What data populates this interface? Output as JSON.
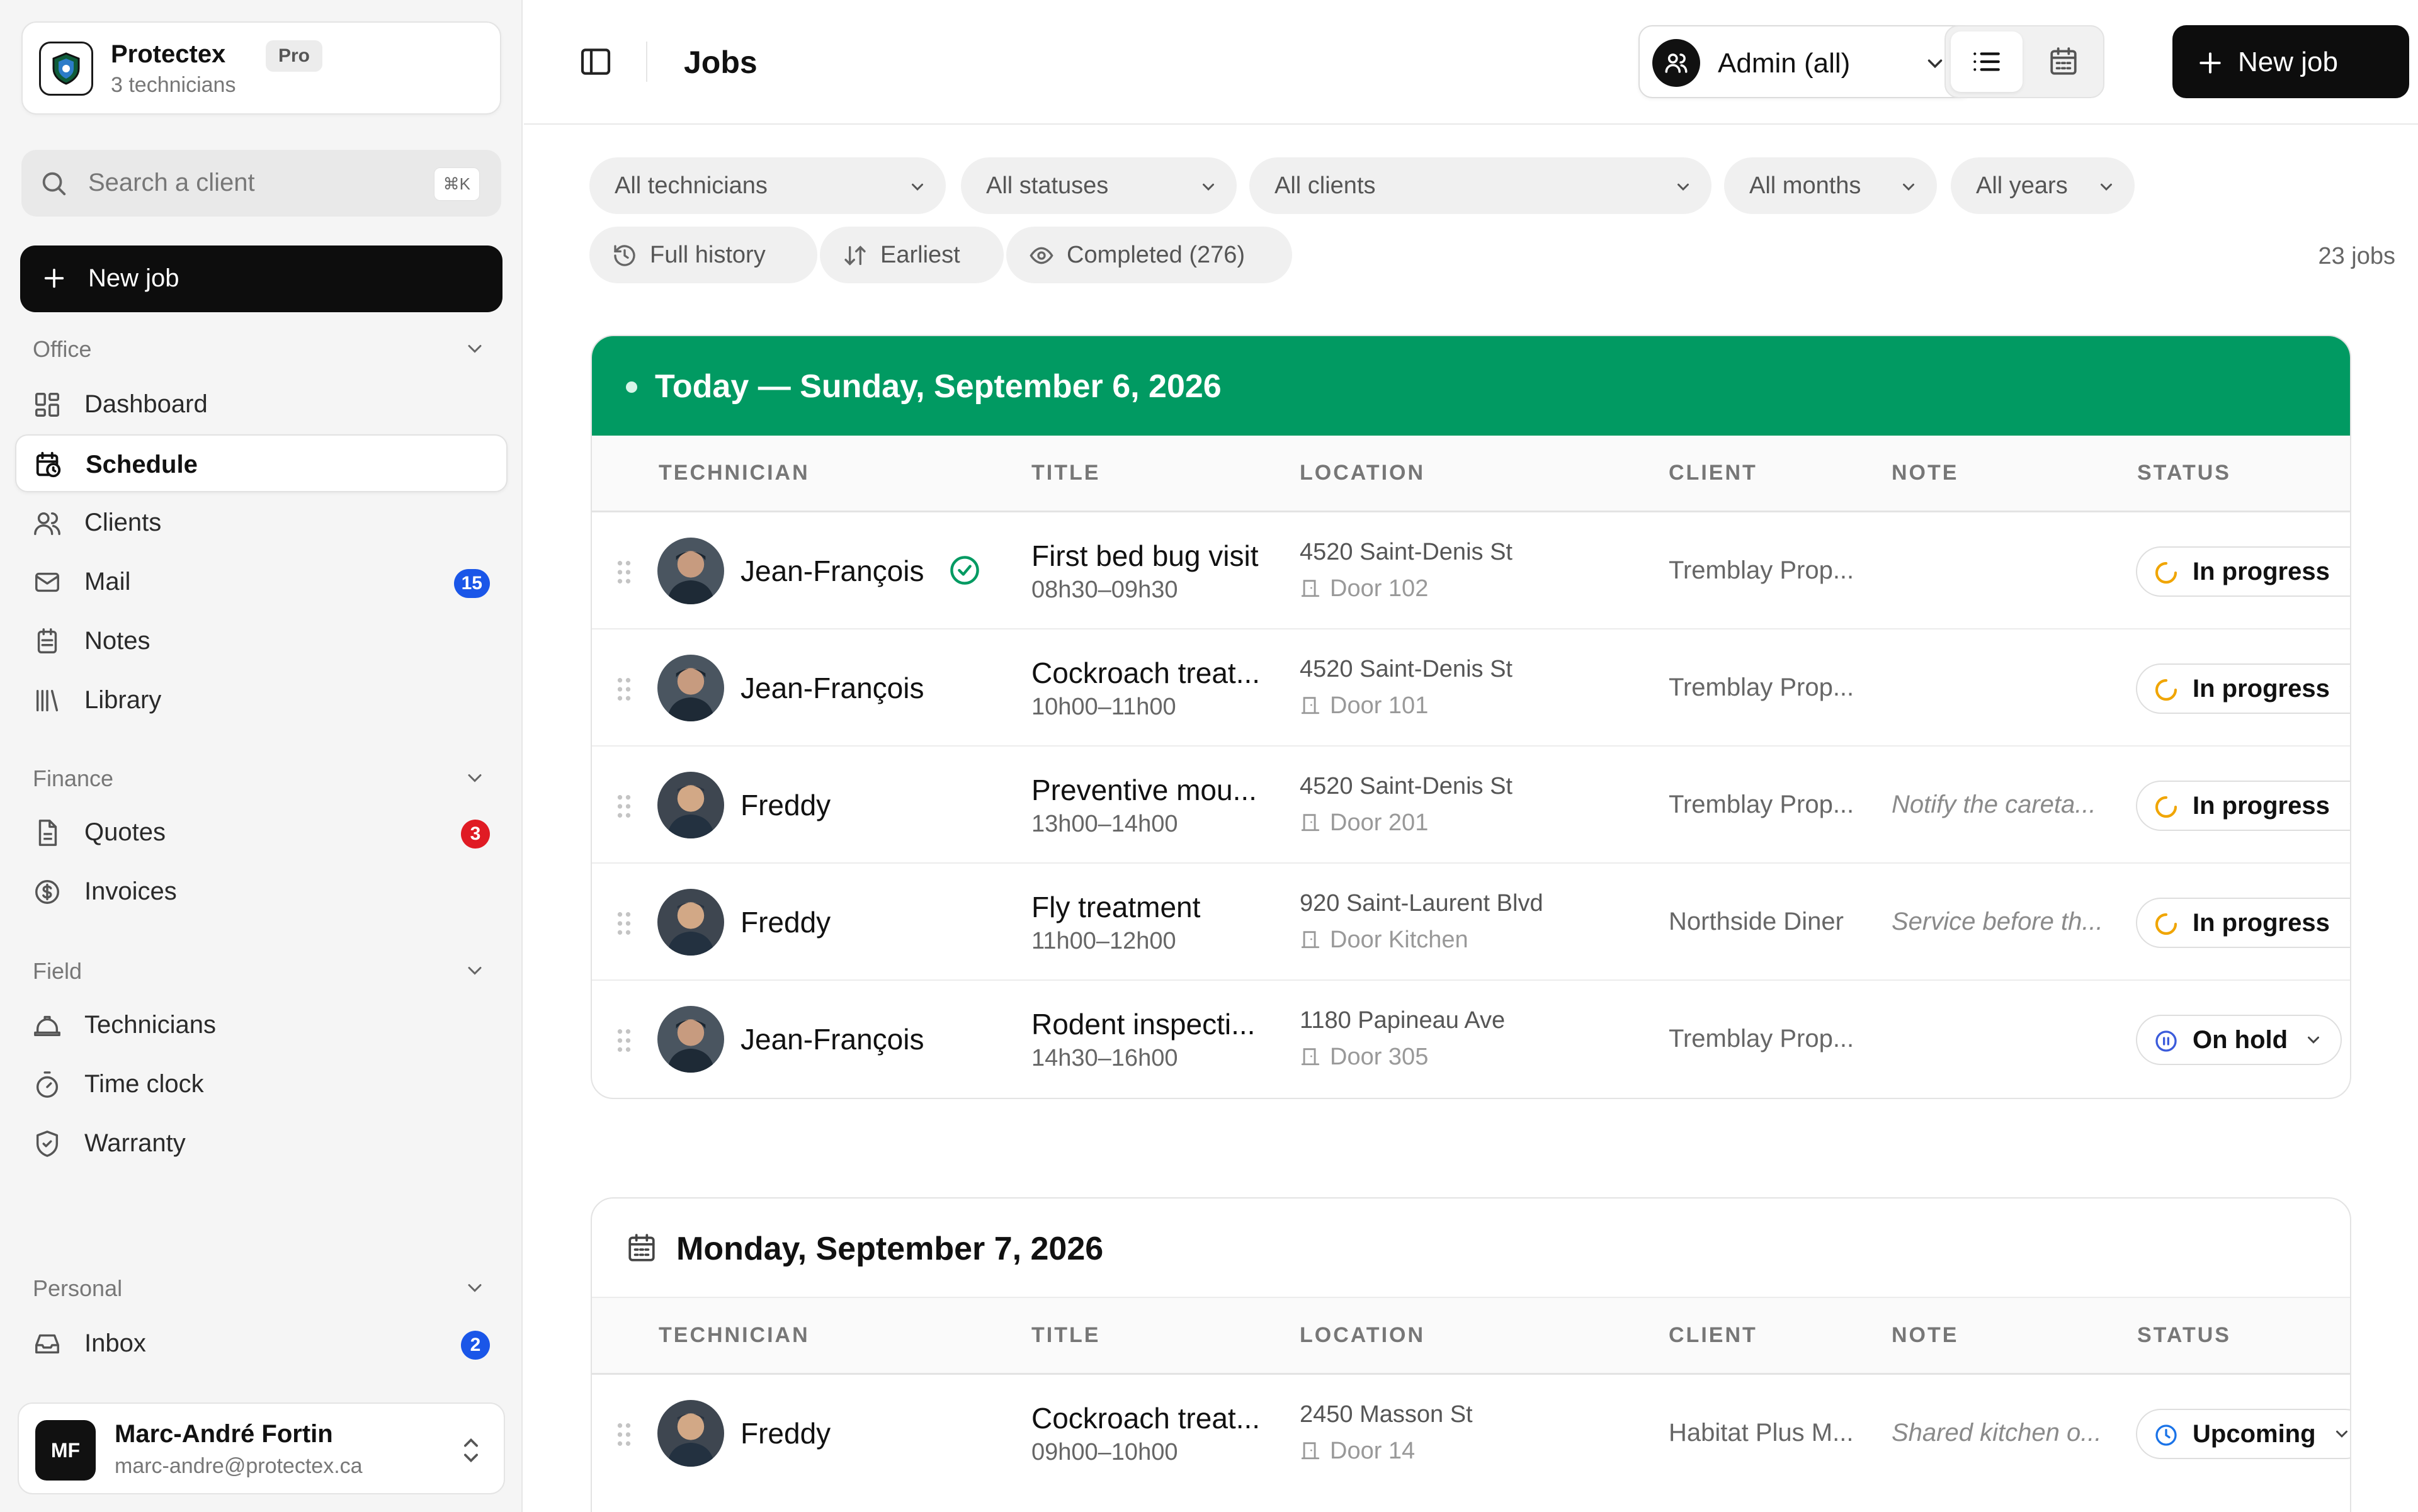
{
  "org": {
    "name": "Protectex",
    "plan": "Pro",
    "subtitle": "3 technicians",
    "logo_text": "PROTECTEX"
  },
  "search": {
    "placeholder": "Search a client",
    "shortcut": "⌘K"
  },
  "sidebar": {
    "new_job_label": "New job",
    "sections": [
      {
        "title": "Office",
        "items": [
          {
            "label": "Dashboard",
            "icon": "dashboard-icon"
          },
          {
            "label": "Schedule",
            "icon": "schedule-icon",
            "active": true
          },
          {
            "label": "Clients",
            "icon": "users-icon"
          },
          {
            "label": "Mail",
            "icon": "mail-icon",
            "badge": "15",
            "badge_color": "#1a56e8"
          },
          {
            "label": "Notes",
            "icon": "notes-icon"
          },
          {
            "label": "Library",
            "icon": "library-icon"
          }
        ]
      },
      {
        "title": "Finance",
        "items": [
          {
            "label": "Quotes",
            "icon": "document-icon",
            "badge": "3",
            "badge_color": "#e01b24"
          },
          {
            "label": "Invoices",
            "icon": "dollar-icon"
          }
        ]
      },
      {
        "title": "Field",
        "items": [
          {
            "label": "Technicians",
            "icon": "hard-hat-icon"
          },
          {
            "label": "Time clock",
            "icon": "stopwatch-icon"
          },
          {
            "label": "Warranty",
            "icon": "shield-check-icon"
          }
        ]
      },
      {
        "title": "Personal",
        "items": [
          {
            "label": "Inbox",
            "icon": "inbox-icon",
            "badge": "2",
            "badge_color": "#1a56e8"
          }
        ]
      }
    ]
  },
  "user": {
    "initials": "MF",
    "name": "Marc-André Fortin",
    "email": "marc-andre@protectex.ca"
  },
  "topbar": {
    "title": "Jobs",
    "admin_label": "Admin (all)",
    "new_job_label": "New job",
    "view_mode": "list"
  },
  "filters": {
    "technicians": "All technicians",
    "statuses": "All statuses",
    "clients": "All clients",
    "months": "All months",
    "years": "All years",
    "history": "Full history",
    "sort": "Earliest",
    "completed": "Completed (276)",
    "jobs_count": "23 jobs"
  },
  "columns": {
    "technician": "TECHNICIAN",
    "title": "TITLE",
    "location": "LOCATION",
    "client": "CLIENT",
    "note": "NOTE",
    "status": "STATUS"
  },
  "colors": {
    "today_green": "#019a62",
    "in_progress": "#f0a500",
    "on_hold": "#3b5bdb",
    "upcoming": "#1a73e8"
  },
  "days": [
    {
      "title": "Today — Sunday, September 6, 2026",
      "is_today": true,
      "jobs": [
        {
          "technician": "Jean-François",
          "verified": true,
          "title": "First bed bug visit",
          "time": "08h30–09h30",
          "address": "4520 Saint-Denis St",
          "door": "Door 102",
          "client": "Tremblay Prop...",
          "note": "",
          "status": "In progress",
          "status_icon": "progress-icon"
        },
        {
          "technician": "Jean-François",
          "verified": false,
          "title": "Cockroach treat...",
          "time": "10h00–11h00",
          "address": "4520 Saint-Denis St",
          "door": "Door 101",
          "client": "Tremblay Prop...",
          "note": "",
          "status": "In progress",
          "status_icon": "progress-icon"
        },
        {
          "technician": "Freddy",
          "verified": false,
          "title": "Preventive mou...",
          "time": "13h00–14h00",
          "address": "4520 Saint-Denis St",
          "door": "Door 201",
          "client": "Tremblay Prop...",
          "note": "Notify the careta...",
          "status": "In progress",
          "status_icon": "progress-icon"
        },
        {
          "technician": "Freddy",
          "verified": false,
          "title": "Fly treatment",
          "time": "11h00–12h00",
          "address": "920 Saint-Laurent Blvd",
          "door": "Door Kitchen",
          "client": "Northside Diner",
          "note": "Service before th...",
          "status": "In progress",
          "status_icon": "progress-icon"
        },
        {
          "technician": "Jean-François",
          "verified": false,
          "title": "Rodent inspecti...",
          "time": "14h30–16h00",
          "address": "1180 Papineau Ave",
          "door": "Door 305",
          "client": "Tremblay Prop...",
          "note": "",
          "status": "On hold",
          "status_icon": "pause-icon"
        }
      ]
    },
    {
      "title": "Monday, September 7, 2026",
      "is_today": false,
      "jobs": [
        {
          "technician": "Freddy",
          "verified": false,
          "title": "Cockroach treat...",
          "time": "09h00–10h00",
          "address": "2450 Masson St",
          "door": "Door 14",
          "client": "Habitat Plus M...",
          "note": "Shared kitchen o...",
          "status": "Upcoming",
          "status_icon": "clock-icon"
        }
      ]
    }
  ]
}
